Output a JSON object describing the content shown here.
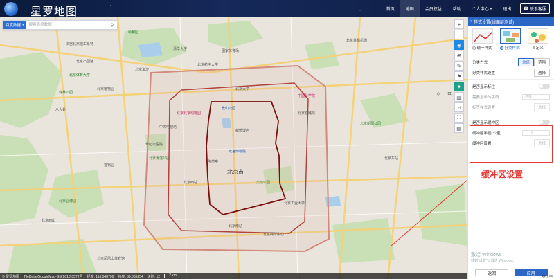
{
  "app": {
    "brand": "星罗地图"
  },
  "nav": {
    "items": [
      {
        "label": "首页",
        "active": false
      },
      {
        "label": "地图",
        "active": true
      },
      {
        "label": "会员权益",
        "active": false
      },
      {
        "label": "帮助",
        "active": false
      },
      {
        "label": "个人中心",
        "active": false
      },
      {
        "label": "退出",
        "active": false
      }
    ],
    "feedback": "联系客服"
  },
  "search": {
    "source": "百度数据",
    "placeholder": "搜索百度数据"
  },
  "map": {
    "pois": {
      "city": "北京市",
      "p1": "旧宫北京理工系特",
      "p2": "北京石园路",
      "p3": "北京航空大学",
      "p4": "北京体育大学",
      "p5": "颐和园",
      "p6": "北京海淀",
      "p7": "清华大学",
      "p8": "北京大学",
      "p9": "北京北京动物园",
      "p10": "中国科学院",
      "p11": "国家体育场",
      "p12": "北京海淀公园",
      "p13": "北京铁路局",
      "p14": "北京凤凰山体育馆",
      "p15": "天坛公园",
      "p16": "故宫博物院",
      "p17": "景山公园",
      "p18": "新侨饭店",
      "p19": "北京东站",
      "p20": "北京首都机场",
      "p21": "北京西站",
      "p22": "北京工业大学",
      "p23": "陶然亭",
      "p24": "北京植物园",
      "p25": "八大处",
      "p26": "森林公园",
      "p27": "北京园博园",
      "p28": "北京南站",
      "p29": "北京网球中心",
      "p30": "中央电视塔",
      "p31": "北京西山",
      "p32": "世纪坛医院",
      "p33": "北京朝阳公园",
      "p34": "首钢园"
    }
  },
  "status": {
    "source": "TileData-GoogleMap-GS(2018)5572号",
    "lng_label": "经度: 116.548796",
    "lat_label": "纬度: 39.835354",
    "zoom_label": "级别: 12",
    "scale": "2 km",
    "credit": "© 星罗地图"
  },
  "panel": {
    "title": "样式设置(线面层测试)",
    "styles": [
      {
        "label": "统一样式",
        "active": false
      },
      {
        "label": "分类样式",
        "active": true
      },
      {
        "label": "自定义",
        "active": false
      }
    ],
    "rows": {
      "classify_method": "分类方式",
      "classify_opt1": "单值",
      "classify_opt2": "范围",
      "classify_style": "分类样式设置",
      "select1": "选择",
      "show_label": "是否显示标注",
      "label_field": "需要显示的字段",
      "label_field_value": "选择",
      "label_style": "标签样式设置",
      "select2": "选择",
      "show_buffer": "是否显示缓冲区",
      "buffer_radius": "缓冲区半径(公里)",
      "buffer_radius_value": "0",
      "buffer_setting": "缓冲区设置",
      "select3": "选择"
    },
    "cancel": "返回",
    "apply": "应用"
  },
  "annotation": "缓冲区设置",
  "watermark": {
    "line1": "激活 Windows",
    "line2": "转到\"设置\"以激活 Windows。"
  },
  "taskbar": "英 ♪ 中"
}
